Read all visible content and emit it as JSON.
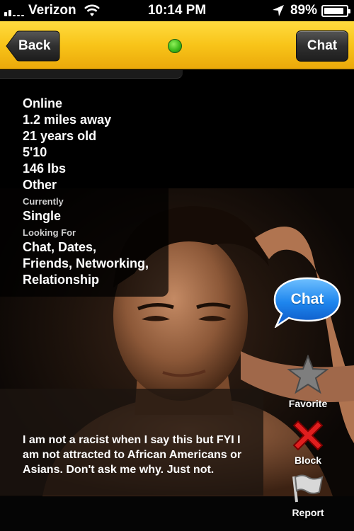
{
  "status_bar": {
    "carrier": "Verizon",
    "time": "10:14 PM",
    "battery": "89%",
    "battery_level": 0.89,
    "icons": [
      "signal-icon",
      "wifi-icon",
      "location-arrow-icon",
      "battery-icon"
    ]
  },
  "nav": {
    "back_label": "Back",
    "chat_label": "Chat",
    "online_indicator_color": "#3fbb1c",
    "bar_color": "#f8c419"
  },
  "profile": {
    "status": "Online",
    "distance": "1.2 miles away",
    "age": "21 years old",
    "height": "5'10",
    "weight": "146 lbs",
    "ethnicity": "Other",
    "currently_label": "Currently",
    "relationship": "Single",
    "looking_for_label": "Looking For",
    "looking_for_line1": "Chat, Dates,",
    "looking_for_line2": "Friends, Networking,",
    "looking_for_line3": "Relationship"
  },
  "about": "I am not a racist when I say this but FYI I am not attracted to African Americans or Asians. Don't ask me why. Just not.",
  "actions": {
    "chat_bubble_label": "Chat",
    "favorite_label": "Favorite",
    "block_label": "Block",
    "report_label": "Report",
    "icons": [
      "star-icon",
      "x-icon",
      "flag-icon"
    ]
  }
}
